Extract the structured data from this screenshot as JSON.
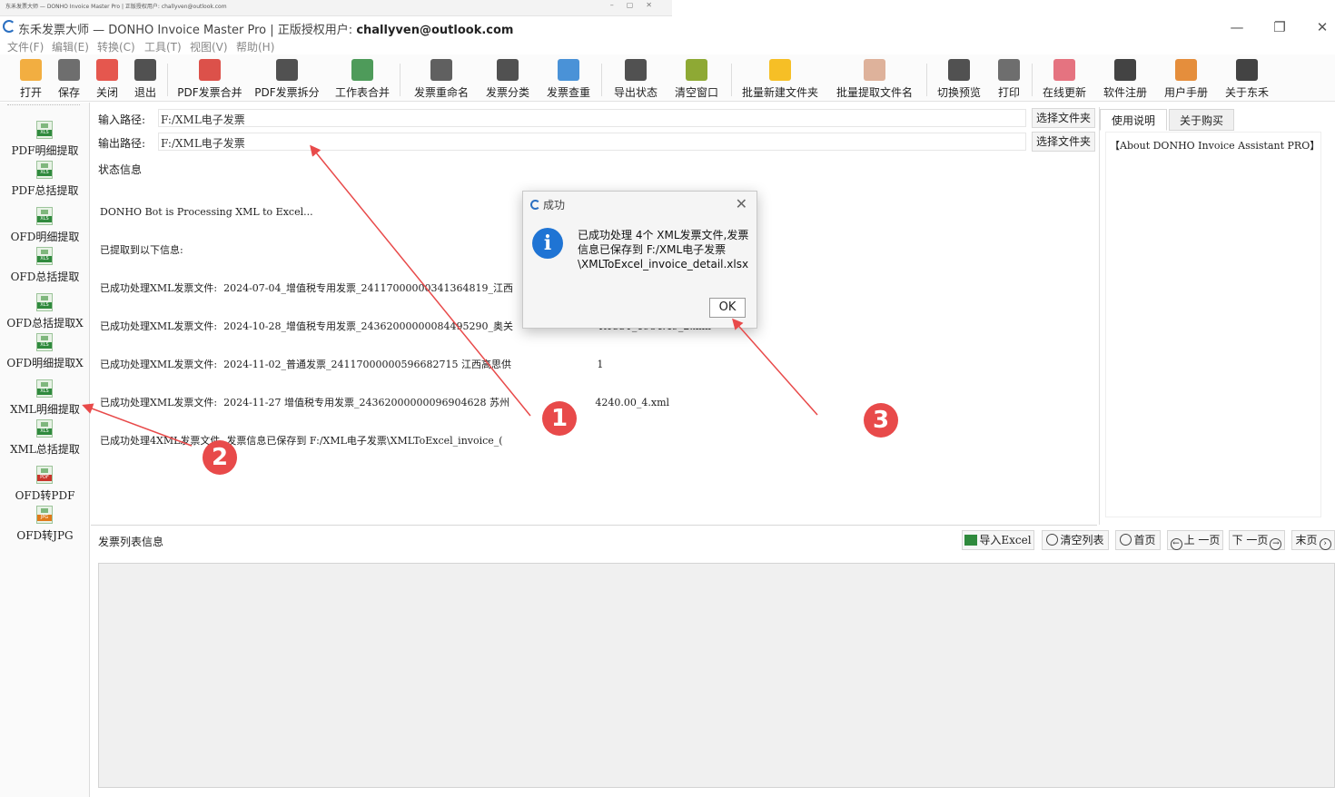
{
  "mini_strip": {
    "text": "东禾发票大师 — DONHO Invoice Master Pro | 正版授权用户: challyven@outlook.com",
    "controls": [
      "–",
      "▢",
      "✕"
    ]
  },
  "window": {
    "title": "东禾发票大师 — DONHO Invoice Master Pro | 正版授权用户:",
    "user": "challyven@outlook.com",
    "minimize": "—",
    "restore": "❐",
    "close": "✕"
  },
  "menu": [
    "文件(F)",
    "编辑(E)",
    "转换(C)",
    "工具(T)",
    "视图(V)",
    "帮助(H)"
  ],
  "toolbar": [
    {
      "label": "打开",
      "icon": "open-folder-icon",
      "color": "#f0a020"
    },
    {
      "label": "保存",
      "icon": "save-icon",
      "color": "#555555"
    },
    {
      "label": "关闭",
      "icon": "close-circle-icon",
      "color": "#e03a2f"
    },
    {
      "label": "退出",
      "icon": "exit-icon",
      "color": "#333333"
    },
    {
      "label": "PDF发票合并",
      "icon": "pdf-merge-icon",
      "color": "#d6322a"
    },
    {
      "label": "PDF发票拆分",
      "icon": "pdf-split-icon",
      "color": "#333333"
    },
    {
      "label": "工作表合并",
      "icon": "sheet-merge-icon",
      "color": "#2f8a3d"
    },
    {
      "label": "发票重命名",
      "icon": "rename-icon",
      "color": "#444444"
    },
    {
      "label": "发票分类",
      "icon": "grid-icon",
      "color": "#333333"
    },
    {
      "label": "发票查重",
      "icon": "duplicate-check-icon",
      "color": "#2a7fd0"
    },
    {
      "label": "导出状态",
      "icon": "export-icon",
      "color": "#333333"
    },
    {
      "label": "清空窗口",
      "icon": "clear-window-icon",
      "color": "#7a9a10"
    },
    {
      "label": "批量新建文件夹",
      "icon": "new-folder-icon",
      "color": "#f4b400"
    },
    {
      "label": "批量提取文件名",
      "icon": "extract-filename-icon",
      "color": "#d8a48a"
    },
    {
      "label": "切换预览",
      "icon": "switch-preview-icon",
      "color": "#333333"
    },
    {
      "label": "打印",
      "icon": "printer-icon",
      "color": "#555555"
    },
    {
      "label": "在线更新",
      "icon": "cloud-update-icon",
      "color": "#e05a6a"
    },
    {
      "label": "软件注册",
      "icon": "user-register-icon",
      "color": "#222222"
    },
    {
      "label": "用户手册",
      "icon": "manual-book-icon",
      "color": "#e07a1a"
    },
    {
      "label": "关于东禾",
      "icon": "info-icon",
      "color": "#222222"
    }
  ],
  "leftnav": [
    {
      "label": "PDF明细提取",
      "icon": "xls-icon",
      "kind": "xls"
    },
    {
      "label": "PDF总括提取",
      "icon": "xls-icon",
      "kind": "xls"
    },
    {
      "label": "OFD明细提取",
      "icon": "xls-icon",
      "kind": "xls"
    },
    {
      "label": "OFD总括提取",
      "icon": "xls-icon",
      "kind": "xls"
    },
    {
      "label": "OFD总括提取X",
      "icon": "xls-icon",
      "kind": "xls"
    },
    {
      "label": "OFD明细提取X",
      "icon": "xls-icon",
      "kind": "xls"
    },
    {
      "label": "XML明细提取",
      "icon": "xls-icon",
      "kind": "xls"
    },
    {
      "label": "XML总括提取",
      "icon": "xls-icon",
      "kind": "xls"
    },
    {
      "label": "OFD转PDF",
      "icon": "pdf-convert-icon",
      "kind": "pdf"
    },
    {
      "label": "OFD转JPG",
      "icon": "jpg-convert-icon",
      "kind": "jpg"
    }
  ],
  "paths": {
    "input_label": "输入路径:",
    "input_value": "F:/XML电子发票",
    "output_label": "输出路径:",
    "output_value": "F:/XML电子发票",
    "browse_label": "选择文件夹"
  },
  "status": {
    "label": "状态信息",
    "lines": [
      "DONHO Bot is Processing XML to Excel...",
      "已提取到以下信息:",
      "已成功处理XML发票文件:  2024-07-04_增值税专用发票_24117000000341364819_江西                           0_1.xml",
      "已成功处理XML发票文件:  2024-10-28_增值税专用发票_24362000000084495290_奥关                           KY53T_1984.49_2.xml",
      "已成功处理XML发票文件:  2024-11-02_普通发票_24117000000596682715 江西高思供                           1",
      "已成功处理XML发票文件:  2024-11-27 增值税专用发票_24362000000096904628 苏州                           4240.00_4.xml",
      "已成功处理4XML发票文件, 发票信息已保存到 F:/XML电子发票\\XMLToExcel_invoice_("
    ]
  },
  "right_panel": {
    "tabs": [
      "使用说明",
      "关于购买"
    ],
    "content": "【About DONHO Invoice Assistant PRO】"
  },
  "list": {
    "label": "发票列表信息",
    "buttons": [
      "导入Excel",
      "清空列表",
      "首页",
      "上 一页",
      "下 一页",
      "末页"
    ]
  },
  "dialog": {
    "title": "成功",
    "message": "已成功处理 4个 XML发票文件,发票信息已保存到 F:/XML电子发票\\XMLToExcel_invoice_detail.xlsx",
    "ok": "OK"
  },
  "annotations": [
    "1",
    "2",
    "3"
  ],
  "colors": {
    "annotation": "#e84a4a",
    "info_blue": "#1f74d4",
    "excel_green": "#2f8a3d"
  }
}
